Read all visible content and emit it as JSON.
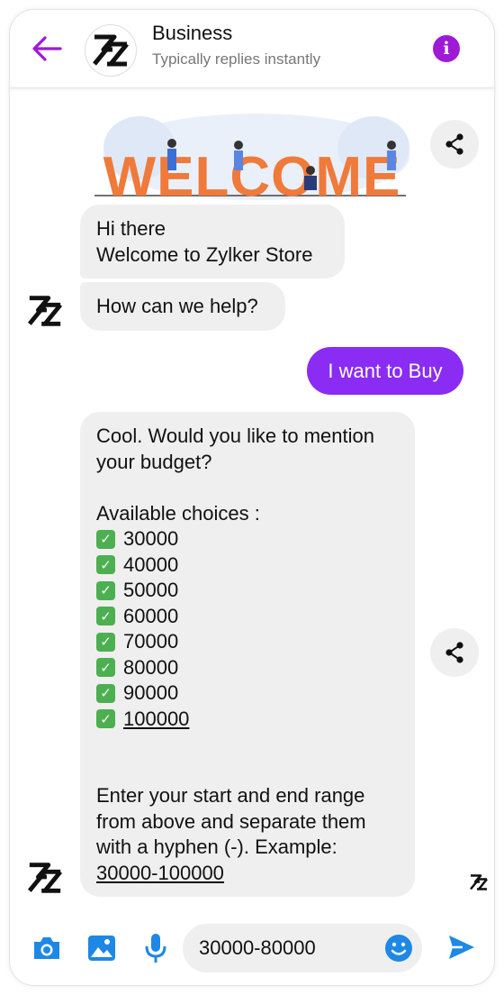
{
  "header": {
    "title": "Business",
    "subtitle": "Typically replies instantly"
  },
  "banner": {
    "text": "WELCOME"
  },
  "messages": {
    "greeting": "Hi there\nWelcome to Zylker Store",
    "help": "How can we help?",
    "user_reply": "I want to Buy",
    "budget_question": "Cool. Would you like to mention\nyour budget?",
    "choices_heading": "Available choices :",
    "choices": [
      "30000",
      "40000",
      "50000",
      "60000",
      "70000",
      "80000",
      "90000",
      "100000"
    ],
    "instruction": "Enter your start and end range\nfrom above and separate them\nwith a hyphen (-). Example:",
    "example": "30000-100000"
  },
  "composer": {
    "input_value": "30000-80000"
  },
  "colors": {
    "accent": "#8a2cf4",
    "info": "#9f1ad6",
    "send": "#1e88e5",
    "bubble": "#efefef"
  },
  "icons": [
    "back-arrow-icon",
    "info-icon",
    "share-icon",
    "camera-icon",
    "image-icon",
    "mic-icon",
    "emoji-icon",
    "send-icon"
  ]
}
